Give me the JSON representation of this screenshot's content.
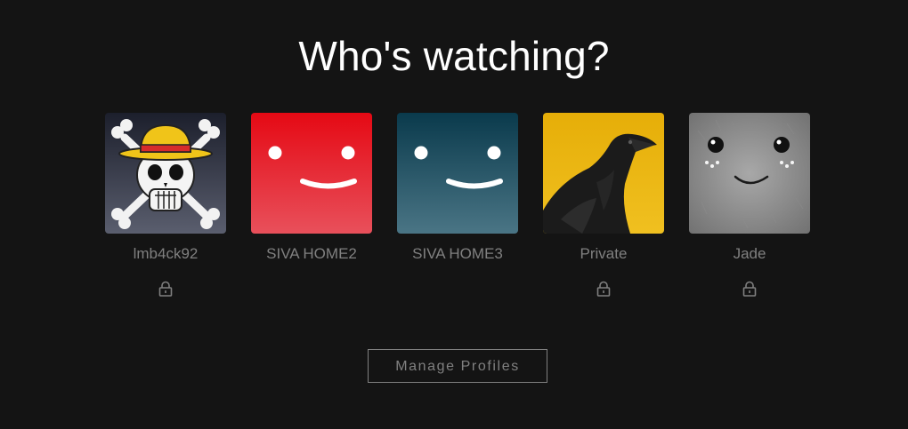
{
  "header": {
    "title": "Who's watching?"
  },
  "profiles": [
    {
      "name": "lmb4ck92",
      "avatar": "straw-hat-jolly-roger",
      "locked": true
    },
    {
      "name": "SIVA HOME2",
      "avatar": "red-smiley",
      "locked": false
    },
    {
      "name": "SIVA HOME3",
      "avatar": "teal-smiley",
      "locked": false
    },
    {
      "name": "Private",
      "avatar": "raven",
      "locked": true
    },
    {
      "name": "Jade",
      "avatar": "grey-fluffy-creature",
      "locked": true
    }
  ],
  "footer": {
    "manage_label": "Manage Profiles"
  },
  "colors": {
    "background": "#141414",
    "title": "#ffffff",
    "muted": "#808080",
    "red_avatar": "#e50914",
    "teal_avatar": "#0f4152",
    "yellow_avatar": "#e8b30c"
  },
  "icons": {
    "lock": "lock-icon"
  }
}
